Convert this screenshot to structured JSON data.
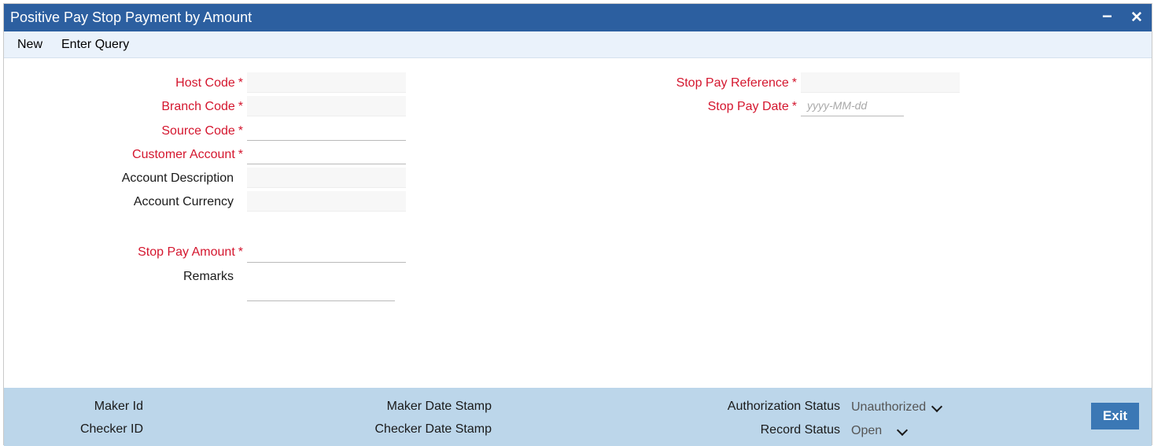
{
  "window": {
    "title": "Positive Pay Stop Payment by Amount",
    "minimize_glyph": "−",
    "close_glyph": "✕"
  },
  "toolbar": {
    "new_label": "New",
    "enter_query_label": "Enter Query"
  },
  "form": {
    "required_marker": "*",
    "host_code": {
      "label": "Host Code",
      "value": ""
    },
    "branch_code": {
      "label": "Branch Code",
      "value": ""
    },
    "source_code": {
      "label": "Source Code",
      "value": ""
    },
    "customer_account": {
      "label": "Customer Account",
      "value": ""
    },
    "account_description": {
      "label": "Account Description",
      "value": ""
    },
    "account_currency": {
      "label": "Account Currency",
      "value": ""
    },
    "stop_pay_amount": {
      "label": "Stop Pay Amount",
      "value": ""
    },
    "remarks": {
      "label": "Remarks",
      "value": ""
    },
    "stop_pay_reference": {
      "label": "Stop Pay Reference",
      "value": ""
    },
    "stop_pay_date": {
      "label": "Stop Pay Date",
      "value": "",
      "placeholder": "yyyy-MM-dd"
    }
  },
  "footer": {
    "maker_id_label": "Maker Id",
    "checker_id_label": "Checker ID",
    "maker_date_stamp_label": "Maker Date Stamp",
    "checker_date_stamp_label": "Checker Date Stamp",
    "authorization_status_label": "Authorization Status",
    "authorization_status_value": "Unauthorized",
    "record_status_label": "Record Status",
    "record_status_value": "Open",
    "exit_label": "Exit"
  },
  "colors": {
    "titlebar": "#2c5fa0",
    "toolbar": "#eaf2fb",
    "required_label": "#d4162e",
    "footer": "#bcd6ea",
    "exit_button": "#3b78b5"
  }
}
